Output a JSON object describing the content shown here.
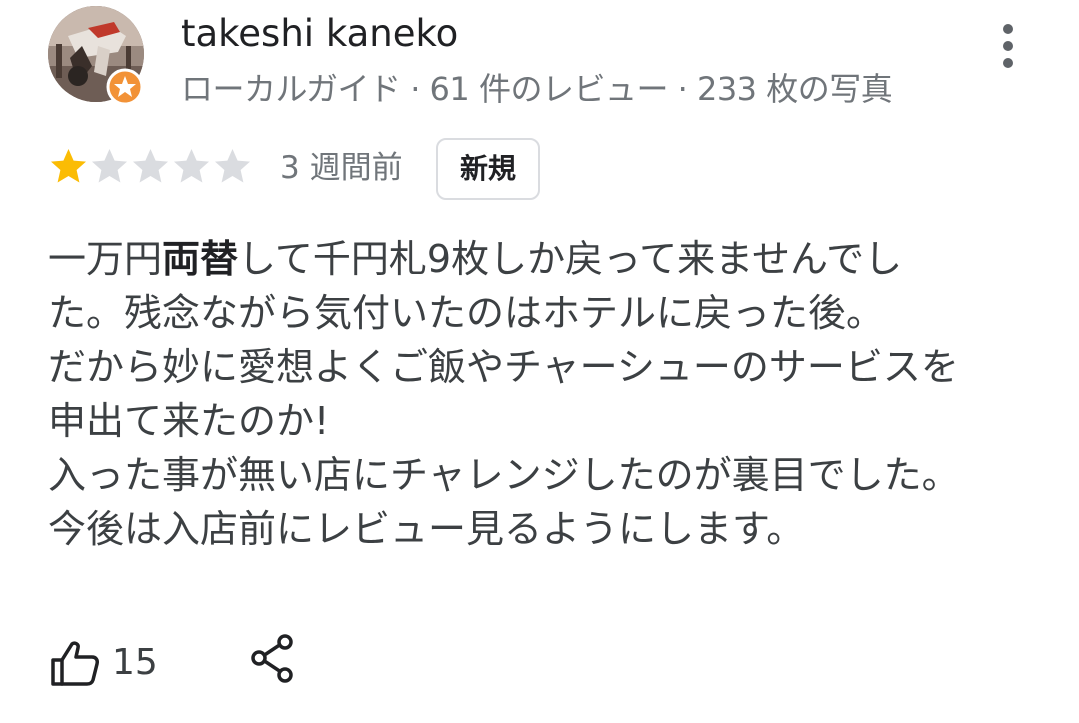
{
  "review": {
    "reviewer": {
      "name": "takeshi kaneko",
      "meta": "ローカルガイド · 61 件のレビュー · 233 枚の写真",
      "avatar_icon": "avatar",
      "badge_icon": "local-guide-badge-icon",
      "badge_color": "#f29237"
    },
    "menu_icon": "more-vert-icon",
    "rating": 1,
    "rating_max": 5,
    "star_filled_color": "#fbbc04",
    "star_empty_color": "#dadce0",
    "date": "3 週間前",
    "badge_label": "新規",
    "body": {
      "intro": "一万円",
      "highlight": "両替",
      "rest": "して千円札9枚しか戻って来ませんでした。残念ながら気付いたのはホテルに戻った後。\nだから妙に愛想よくご飯やチャーシューのサービスを申出て来たのか!\n入った事が無い店にチャレンジしたのが裏目でした。今後は入店前にレビュー見るようにします。"
    },
    "like_count": "15",
    "like_icon": "thumb-up-icon",
    "share_icon": "share-icon"
  }
}
